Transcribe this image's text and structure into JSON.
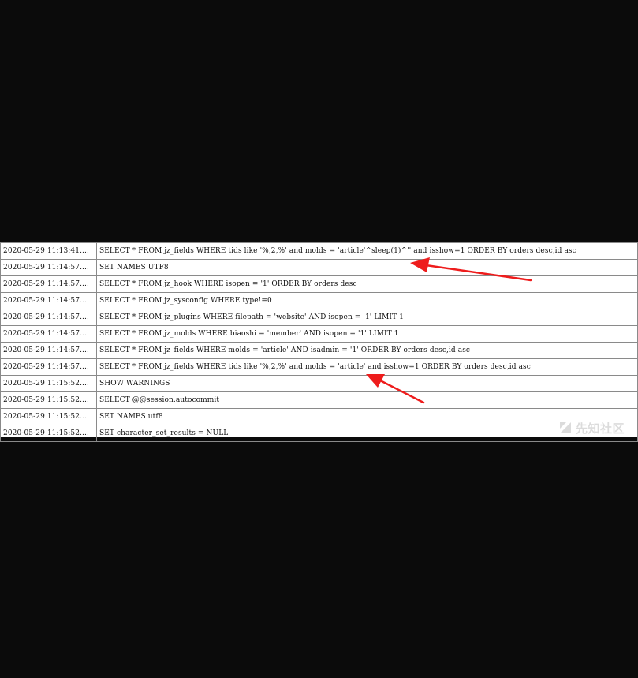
{
  "log": {
    "rows": [
      {
        "time": "2020-05-29 11:13:41....",
        "query": "SELECT * FROM jz_fields WHERE  tids like '%,2,%'  and  molds = 'article'^sleep(1)^''  and isshow=1  ORDER BY  orders desc,id asc"
      },
      {
        "time": "2020-05-29 11:14:57....",
        "query": "SET NAMES UTF8"
      },
      {
        "time": "2020-05-29 11:14:57....",
        "query": "SELECT * FROM jz_hook WHERE isopen = '1' ORDER BY  orders desc"
      },
      {
        "time": "2020-05-29 11:14:57....",
        "query": "SELECT * FROM jz_sysconfig WHERE type!=0"
      },
      {
        "time": "2020-05-29 11:14:57....",
        "query": "SELECT * FROM jz_plugins WHERE filepath = 'website' AND isopen = '1' LIMIT 1"
      },
      {
        "time": "2020-05-29 11:14:57....",
        "query": "SELECT * FROM jz_molds WHERE biaoshi = 'member' AND isopen = '1' LIMIT 1"
      },
      {
        "time": "2020-05-29 11:14:57....",
        "query": "SELECT * FROM jz_fields WHERE molds = 'article' AND isadmin = '1' ORDER BY  orders desc,id asc"
      },
      {
        "time": "2020-05-29 11:14:57....",
        "query": "SELECT * FROM jz_fields WHERE  tids like '%,2,%'  and  molds = 'article'  and isshow=1  ORDER BY  orders desc,id asc"
      },
      {
        "time": "2020-05-29 11:15:52....",
        "query": "SHOW WARNINGS"
      },
      {
        "time": "2020-05-29 11:15:52....",
        "query": "SELECT @@session.autocommit"
      },
      {
        "time": "2020-05-29 11:15:52....",
        "query": "SET NAMES utf8"
      },
      {
        "time": "2020-05-29 11:15:52....",
        "query": "SET character_set_results = NULL"
      }
    ]
  },
  "watermark": {
    "text": "先知社区",
    "icon": "xianzhi-logo-icon"
  },
  "annotations": {
    "arrow_color": "#ee1c1c",
    "arrows": [
      "pointer-arrow-icon",
      "pointer-arrow-icon"
    ]
  },
  "colors": {
    "background": "#0b0b0b",
    "panel": "#ffffff",
    "grid": "#8a8a8a"
  }
}
